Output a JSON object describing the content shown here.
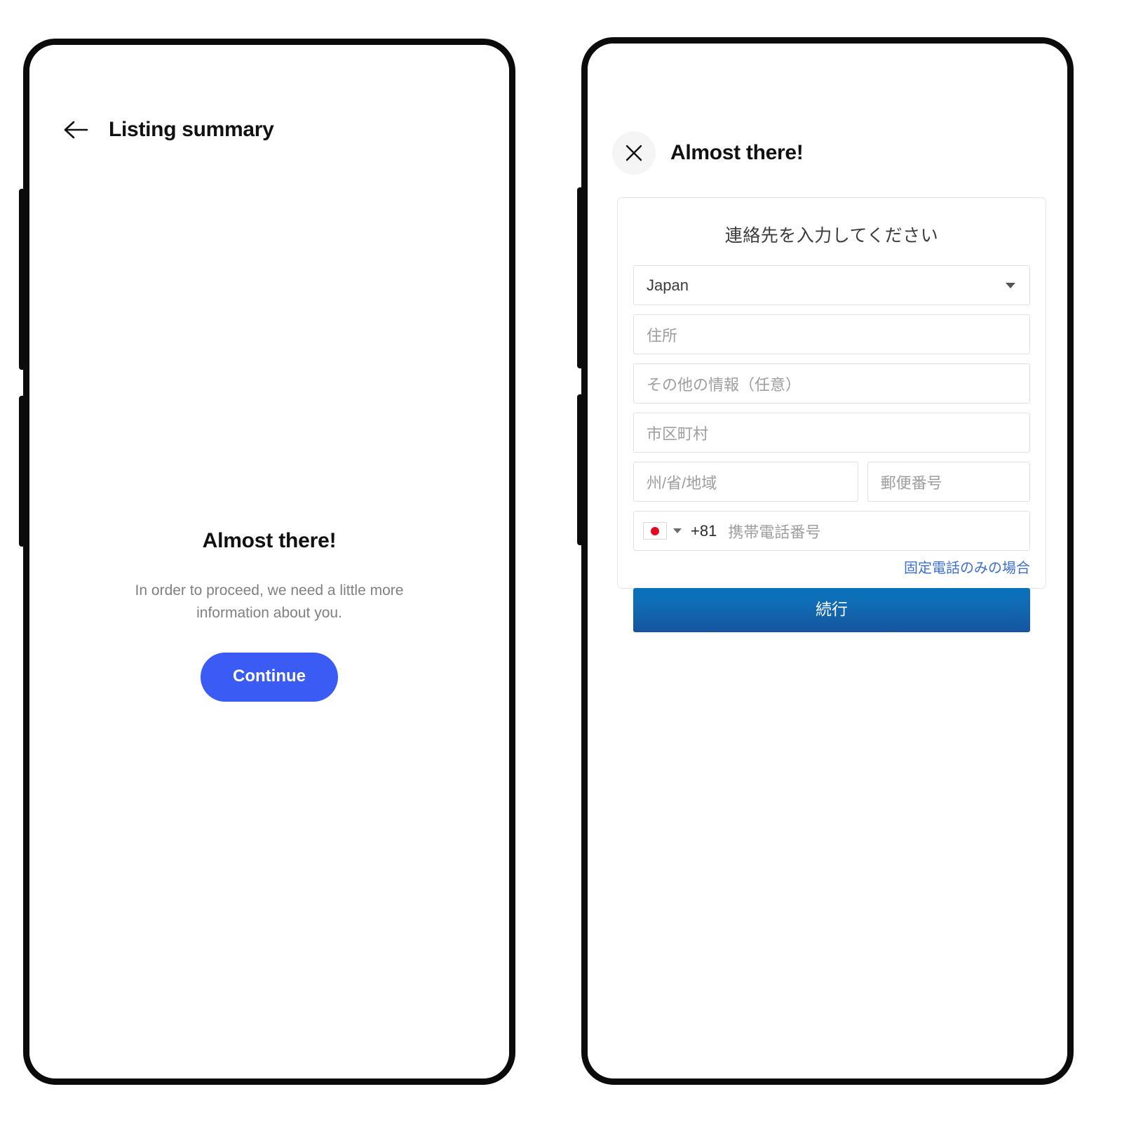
{
  "screens": [
    {
      "id": "listing-summary",
      "header": {
        "back_icon": "arrow-left-icon",
        "title": "Listing summary"
      },
      "content": {
        "heading": "Almost there!",
        "body": "In order to proceed, we need a little more information about you.",
        "primary_button": "Continue"
      }
    },
    {
      "id": "contact-details",
      "header": {
        "close_icon": "close-icon",
        "title": "Almost there!"
      },
      "form": {
        "heading": "連絡先を入力してください",
        "country": {
          "label": "Japan",
          "caret_icon": "chevron-down-icon"
        },
        "fields": [
          {
            "name": "address",
            "placeholder": "住所"
          },
          {
            "name": "address2",
            "placeholder": "その他の情報（任意）"
          },
          {
            "name": "city",
            "placeholder": "市区町村"
          }
        ],
        "state": {
          "placeholder": "州/省/地域"
        },
        "zip": {
          "placeholder": "郵便番号"
        },
        "phone": {
          "flag_icon": "japan-flag-icon",
          "caret_icon": "chevron-down-icon",
          "dial_code": "+81",
          "placeholder": "携帯電話番号"
        },
        "landline_link": "固定電話のみの場合",
        "submit_button": "続行"
      }
    }
  ],
  "colors": {
    "accent_blue": "#3b5bf5",
    "submit_blue_top": "#0a72bd",
    "submit_blue_bottom": "#16559e",
    "link_blue": "#3d6fd0",
    "flag_red": "#e00b22",
    "text_primary": "#111111",
    "text_muted": "#808080",
    "frame_black": "#0b0b0b"
  }
}
